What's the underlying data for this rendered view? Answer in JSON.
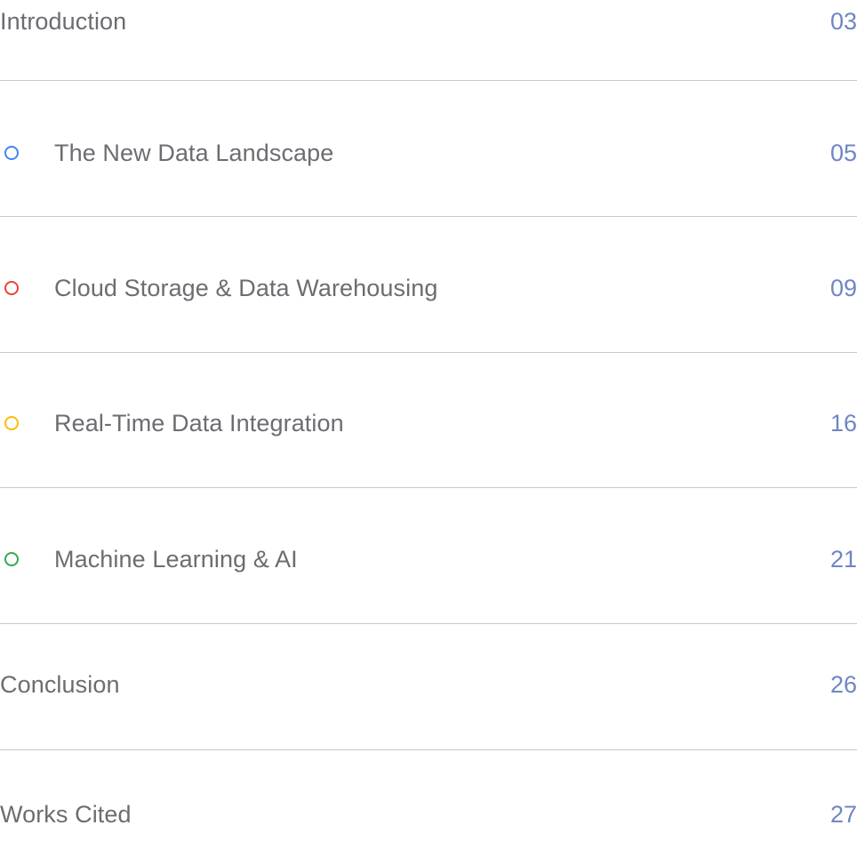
{
  "toc": {
    "items": [
      {
        "title": "Introduction",
        "page": "03",
        "bullet": null
      },
      {
        "title": "The New Data Landscape",
        "page": "05",
        "bullet": "#4285f4"
      },
      {
        "title": "Cloud Storage & Data Warehousing",
        "page": "09",
        "bullet": "#ea4335"
      },
      {
        "title": "Real-Time Data Integration",
        "page": "16",
        "bullet": "#fbbc04"
      },
      {
        "title": "Machine Learning & AI",
        "page": "21",
        "bullet": "#34a853"
      },
      {
        "title": "Conclusion",
        "page": "26",
        "bullet": null
      },
      {
        "title": "Works Cited",
        "page": "27",
        "bullet": null
      }
    ]
  }
}
